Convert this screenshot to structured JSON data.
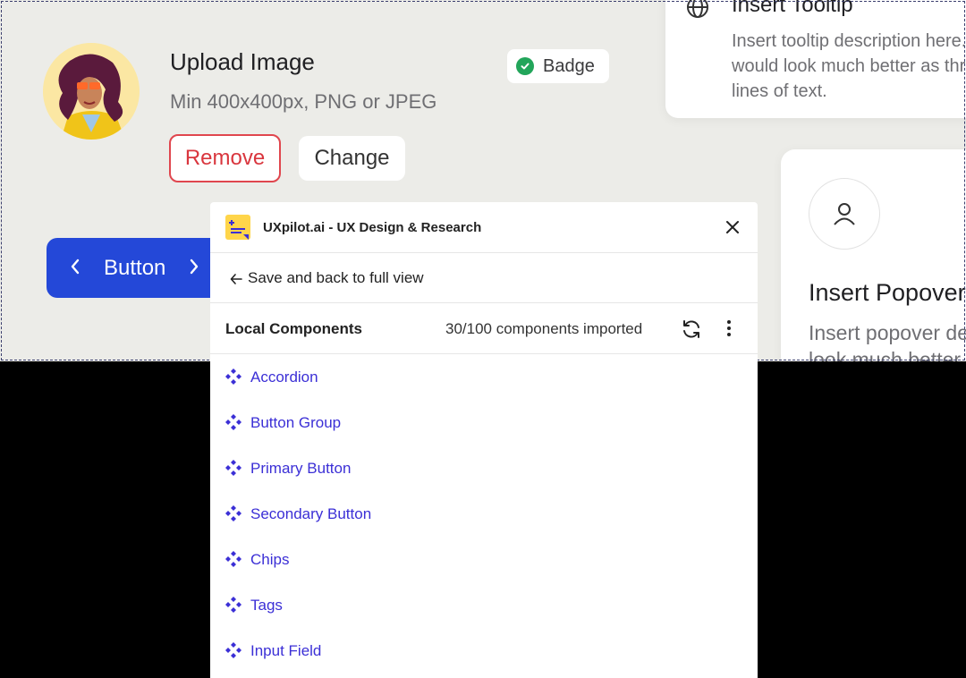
{
  "canvas": {
    "upload": {
      "title": "Upload Image",
      "subtitle": "Min 400x400px, PNG or JPEG",
      "remove_label": "Remove",
      "change_label": "Change"
    },
    "badge": {
      "label": "Badge",
      "color": "#22a55a"
    },
    "blue_button": {
      "label": "Button",
      "color": "#2448d8"
    },
    "tooltip": {
      "title": "Insert Tooltip",
      "lines": [
        "Insert tooltip description here.",
        "would look much better as three",
        "lines of text."
      ]
    },
    "popover": {
      "title": "Insert Popover",
      "description": "Insert popover description",
      "description2": "look much better"
    }
  },
  "panel": {
    "title": "UXpilot.ai - UX Design & Research",
    "back_label": "Save and back to full view",
    "local_label": "Local Components",
    "import_count": "30/100 components imported",
    "accent": "#3b2fd6",
    "components": [
      {
        "label": "Accordion"
      },
      {
        "label": "Button Group"
      },
      {
        "label": "Primary Button"
      },
      {
        "label": "Secondary Button"
      },
      {
        "label": "Chips"
      },
      {
        "label": "Tags"
      },
      {
        "label": "Input Field"
      }
    ]
  }
}
